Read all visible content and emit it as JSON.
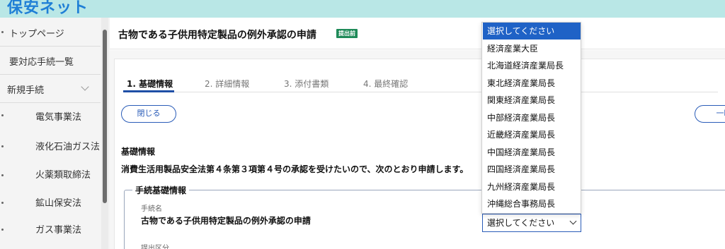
{
  "header": {
    "logo_text": "保安ネット"
  },
  "sidebar": {
    "items": [
      {
        "label": "トップページ"
      },
      {
        "label": "要対応手続一覧"
      },
      {
        "label": "新規手続"
      },
      {
        "label": "電気事業法"
      },
      {
        "label": "液化石油ガス法"
      },
      {
        "label": "火薬類取締法"
      },
      {
        "label": "鉱山保安法"
      },
      {
        "label": "ガス事業法"
      }
    ]
  },
  "page": {
    "title": "古物である子供用特定製品の例外承認の申請",
    "badge": "提出前"
  },
  "steps": [
    {
      "label": "1. 基礎情報"
    },
    {
      "label": "2. 詳細情報"
    },
    {
      "label": "3. 添付書類"
    },
    {
      "label": "4. 最終確認"
    }
  ],
  "buttons": {
    "close": "閉じる",
    "temp_save": "一時保"
  },
  "section": {
    "heading": "基礎情報",
    "lead": "消費生活用製品安全法第４条第３項第４号の承認を受けたいので、次のとおり申請します。"
  },
  "fieldset": {
    "legend": "手続基礎情報",
    "procedure_name_label": "手続名",
    "procedure_name_value": "古物である子供用特定製品の例外承認の申請",
    "submission_label": "提出区分"
  },
  "select": {
    "current_value": "選択してください",
    "options": [
      "選択してください",
      "経済産業大臣",
      "北海道経済産業局長",
      "東北経済産業局長",
      "関東経済産業局長",
      "中部経済産業局長",
      "近畿経済産業局長",
      "中国経済産業局長",
      "四国経済産業局長",
      "九州経済産業局長",
      "沖縄総合事務局長"
    ]
  },
  "colors": {
    "accent": "#1f62c6",
    "badge": "#1e8a58",
    "header_band": "#b9e7e6"
  }
}
